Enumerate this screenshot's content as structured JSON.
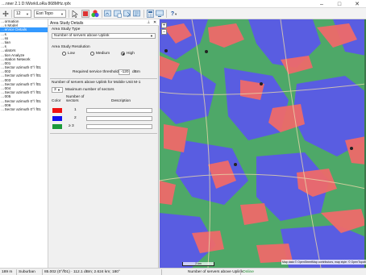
{
  "window": {
    "title": "…nner 2.1 D:\\Work\\LoRa 868MHz.rpfx"
  },
  "toolbar": {
    "zoom_value": "12",
    "basemap_value": "Esri Topo",
    "icons": [
      "cursor-icon",
      "layers-icon",
      "palette-icon",
      "map-add-icon",
      "map-copy-icon",
      "map-export-icon",
      "map-report-icon",
      "calculator-icon",
      "monitor-icon",
      "help-icon"
    ],
    "help_label": "?"
  },
  "tree": {
    "items": [
      "…ormation",
      "…n Model",
      "…ervice Details",
      "…s",
      "…ss",
      "…tian",
      "…s",
      "…ulators",
      "…tion Analyze",
      "…ntation Network",
      "…001",
      "…Sector azimuth 0°/ f01",
      "…002",
      "…Sector azimuth 0°/ f01",
      "…003",
      "…Sector azimuth 0°/ f01",
      "…004",
      "…Sector azimuth 0°/ f01",
      "…005",
      "…Sector azimuth 0°/ f01",
      "…006",
      "…Sector azimuth 0°/ f01"
    ],
    "selected_index": 2
  },
  "panel": {
    "title": "Area Study Details",
    "study_type_label": "Area Study Type",
    "study_type_value": "Number of servers above Uplink",
    "resolution_label": "Area Study Resolution",
    "resolution_options": [
      "Low",
      "Medium",
      "High"
    ],
    "resolution_selected": "High",
    "threshold_label": "Required service threshold",
    "threshold_value": "-120",
    "threshold_unit": "dBm",
    "servers_heading": "Number of servers above Uplink for Mobile Unit M-1",
    "max_count_value": "3",
    "max_sectors_label": "Maximum number of sectors",
    "col_color": "Color",
    "col_number": "Number of sectors",
    "col_description": "Description",
    "rows": [
      {
        "color": "#ee1111",
        "number": "1"
      },
      {
        "color": "#1111ee",
        "number": "2"
      },
      {
        "color": "#1a9a3a",
        "number": "≥ 3"
      }
    ]
  },
  "map": {
    "plus_label": "+",
    "minus_label": "−",
    "scale_label": "2 km",
    "attribution": "Map data © OpenStreetMap contributors, map style: © OpenTopoMap"
  },
  "status": {
    "zoom": "189 m",
    "clutter": "Suburban",
    "readout": "85.002 (0°/f01) · 112.1 dBm; 2.624 km; 180°",
    "study": "Number of servers above Uplink",
    "connection": "Online"
  }
}
